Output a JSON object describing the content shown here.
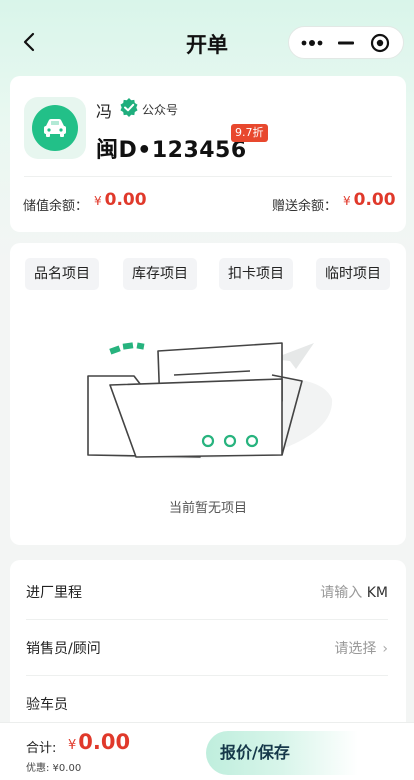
{
  "header": {
    "title": "开单",
    "back_icon": "chevron-left-icon",
    "capsule_icons": [
      "more-dots-icon",
      "minimize-icon",
      "close-target-icon"
    ]
  },
  "customer": {
    "name": "冯",
    "verified_label": "公众号",
    "plate": "闽D•123456",
    "discount": "9.7折",
    "stored_balance_label": "储值余额：",
    "stored_balance_currency": "¥",
    "stored_balance": "0.00",
    "gift_balance_label": "赠送余额：",
    "gift_balance_currency": "¥",
    "gift_balance": "0.00"
  },
  "categories": [
    "品名项目",
    "库存项目",
    "扣卡项目",
    "临时项目"
  ],
  "items": {
    "empty_text": "当前暂无项目"
  },
  "form": {
    "mileage_label": "进厂里程",
    "mileage_placeholder": "请输入",
    "mileage_unit": "KM",
    "sales_label": "销售员/顾问",
    "sales_placeholder": "请选择",
    "inspector_label": "验车员"
  },
  "footer": {
    "total_label": "合计:",
    "total_currency": "¥",
    "total": "0.00",
    "discount_text": "优惠: ¥0.00",
    "quote_button": "报价/保存"
  },
  "colors": {
    "accent": "#22c088",
    "price": "#e0392b",
    "badge": "#e8482e"
  }
}
